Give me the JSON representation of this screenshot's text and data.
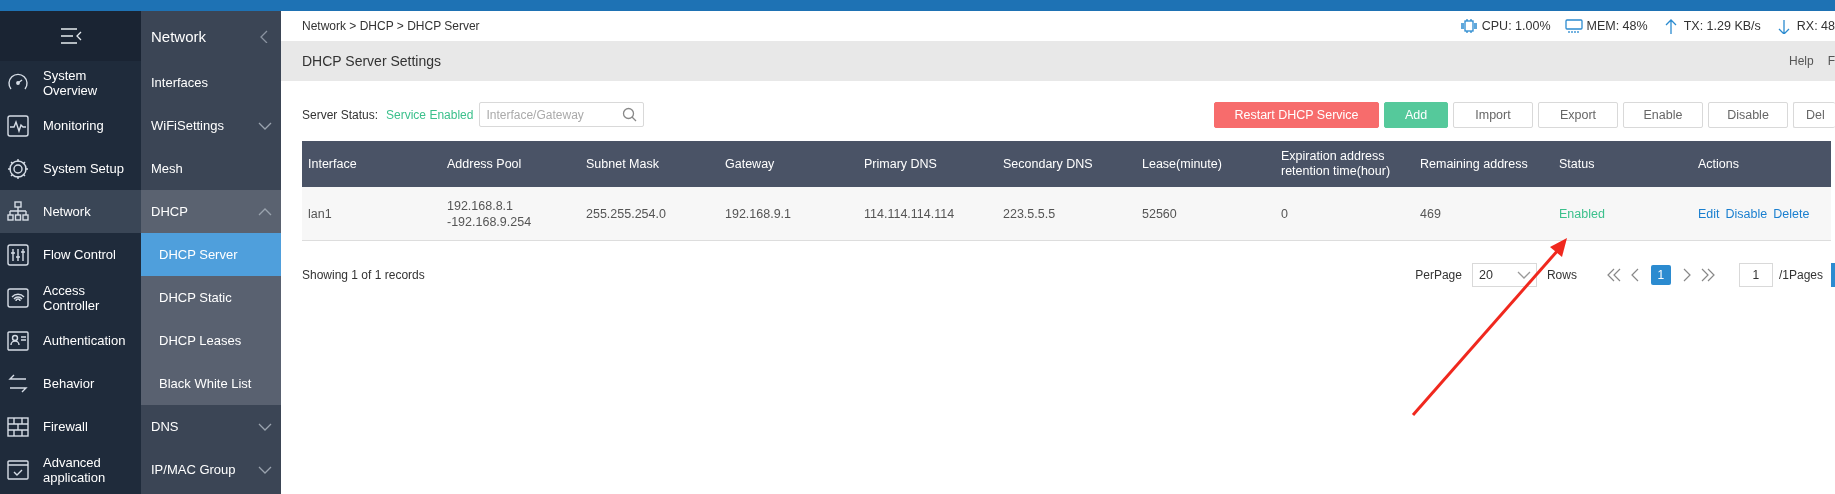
{
  "top_bar": {
    "breadcrumb": "Network > DHCP > DHCP Server",
    "stats": [
      {
        "kind": "cpu",
        "text": "CPU: 1.00%"
      },
      {
        "kind": "mem",
        "text": "MEM: 48%"
      },
      {
        "kind": "tx",
        "text": "TX: 1.29 KB/s"
      },
      {
        "kind": "rx",
        "text": "RX: 48"
      }
    ]
  },
  "sidebar": {
    "items": [
      {
        "label": "System Overview",
        "selected": false
      },
      {
        "label": "Monitoring",
        "selected": false
      },
      {
        "label": "System Setup",
        "selected": false
      },
      {
        "label": "Network",
        "selected": true
      },
      {
        "label": "Flow Control",
        "selected": false
      },
      {
        "label": "Access Controller",
        "selected": false
      },
      {
        "label": "Authentication",
        "selected": false
      },
      {
        "label": "Behavior",
        "selected": false
      },
      {
        "label": "Firewall",
        "selected": false
      },
      {
        "label": "Advanced application",
        "selected": false
      }
    ]
  },
  "subnav": {
    "title": "Network",
    "items": [
      {
        "label": "Interfaces",
        "selected": false
      },
      {
        "label": "WiFiSettings",
        "selected": false,
        "expanded": false
      },
      {
        "label": "Mesh",
        "selected": false
      },
      {
        "label": "DHCP",
        "selected": false,
        "expanded": true,
        "children": [
          {
            "label": "DHCP Server",
            "selected": true
          },
          {
            "label": "DHCP Static",
            "selected": false
          },
          {
            "label": "DHCP Leases",
            "selected": false
          },
          {
            "label": "Black White List",
            "selected": false
          }
        ]
      },
      {
        "label": "DNS",
        "selected": false,
        "expanded": false
      },
      {
        "label": "IP/MAC Group",
        "selected": false,
        "expanded": false
      }
    ]
  },
  "page_header": {
    "title": "DHCP Server Settings",
    "links": [
      "Help",
      "F"
    ]
  },
  "toolbar": {
    "server_status_label": "Server Status:",
    "server_status": "Service Enabled",
    "service_enabled": true,
    "search": {
      "placeholder": "Interface/Gateway"
    },
    "buttons": [
      {
        "label": "Restart DHCP Service",
        "kind": "danger"
      },
      {
        "label": "Add",
        "kind": "primary"
      },
      {
        "label": "Import",
        "kind": "default"
      },
      {
        "label": "Export",
        "kind": "default"
      },
      {
        "label": "Enable",
        "kind": "default"
      },
      {
        "label": "Disable",
        "kind": "default"
      },
      {
        "label": "Del",
        "kind": "default"
      }
    ]
  },
  "table": {
    "columns": [
      "Interface",
      "Address Pool",
      "Subnet Mask",
      "Gateway",
      "Primary DNS",
      "Secondary DNS",
      "Lease(minute)",
      "Expiration address retention time(hour)",
      "Remaining address",
      "Status",
      "Actions"
    ],
    "rows": [
      {
        "cells": [
          "lan1",
          "192.168.8.1\n-192.168.9.254",
          "255.255.254.0",
          "192.168.9.1",
          "114.114.114.114",
          "223.5.5.5",
          "52560",
          "0",
          "469"
        ],
        "status": "Enabled",
        "enabled": true,
        "actions": [
          "Edit",
          "Disable",
          "Delete"
        ]
      }
    ]
  },
  "pagination": {
    "summary": "Showing 1 of 1 records",
    "per_page_label": "PerPage",
    "per_page": "20",
    "rows_label": "Rows",
    "pages": [
      {
        "label": "1",
        "selected": true
      }
    ],
    "page_input": "1",
    "page_total": "/1Pages"
  },
  "annotations": [
    {
      "kind": "arrow"
    }
  ]
}
